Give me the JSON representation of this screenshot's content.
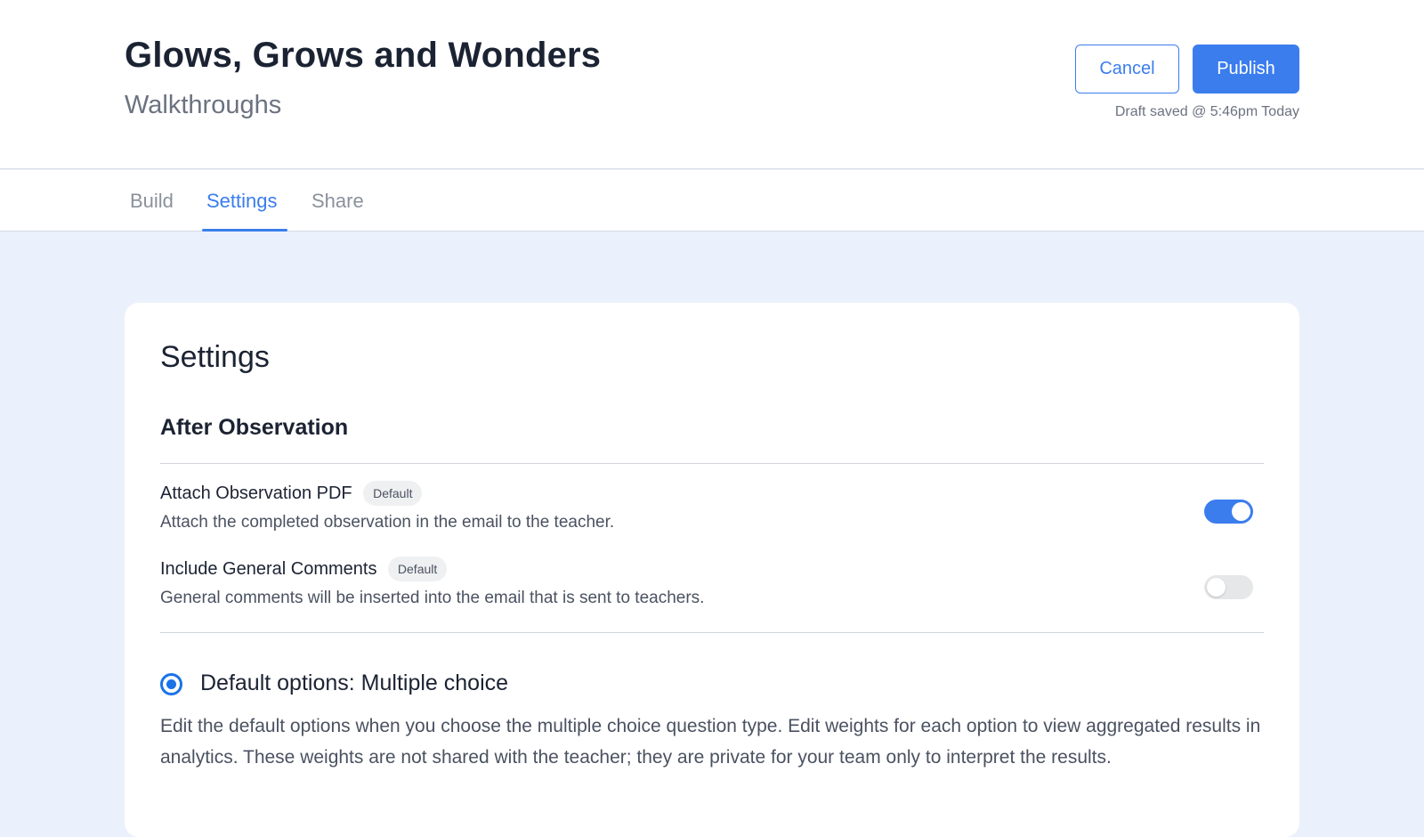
{
  "header": {
    "title": "Glows, Grows and Wonders",
    "subtitle": "Walkthroughs",
    "cancel_label": "Cancel",
    "publish_label": "Publish",
    "draft_status": "Draft saved @ 5:46pm Today"
  },
  "tabs": [
    {
      "label": "Build",
      "active": false
    },
    {
      "label": "Settings",
      "active": true
    },
    {
      "label": "Share",
      "active": false
    }
  ],
  "settings": {
    "title": "Settings",
    "section_title": "After Observation",
    "items": [
      {
        "name": "Attach Observation PDF",
        "badge": "Default",
        "description": "Attach the completed observation in the email to the teacher.",
        "enabled": true
      },
      {
        "name": "Include General Comments",
        "badge": "Default",
        "description": "General comments will be inserted into the email that is sent to teachers.",
        "enabled": false
      }
    ],
    "option": {
      "selected": true,
      "title": "Default options: Multiple choice",
      "description": "Edit the default options when you choose the multiple choice question type. Edit weights for each option to view aggregated results in analytics. These weights are not shared with the teacher; they are private for your team only to interpret the results."
    }
  },
  "colors": {
    "accent": "#3b7ded",
    "page_background": "#ebf1fc",
    "text": "#1b2333",
    "muted_text": "#4a5261"
  }
}
